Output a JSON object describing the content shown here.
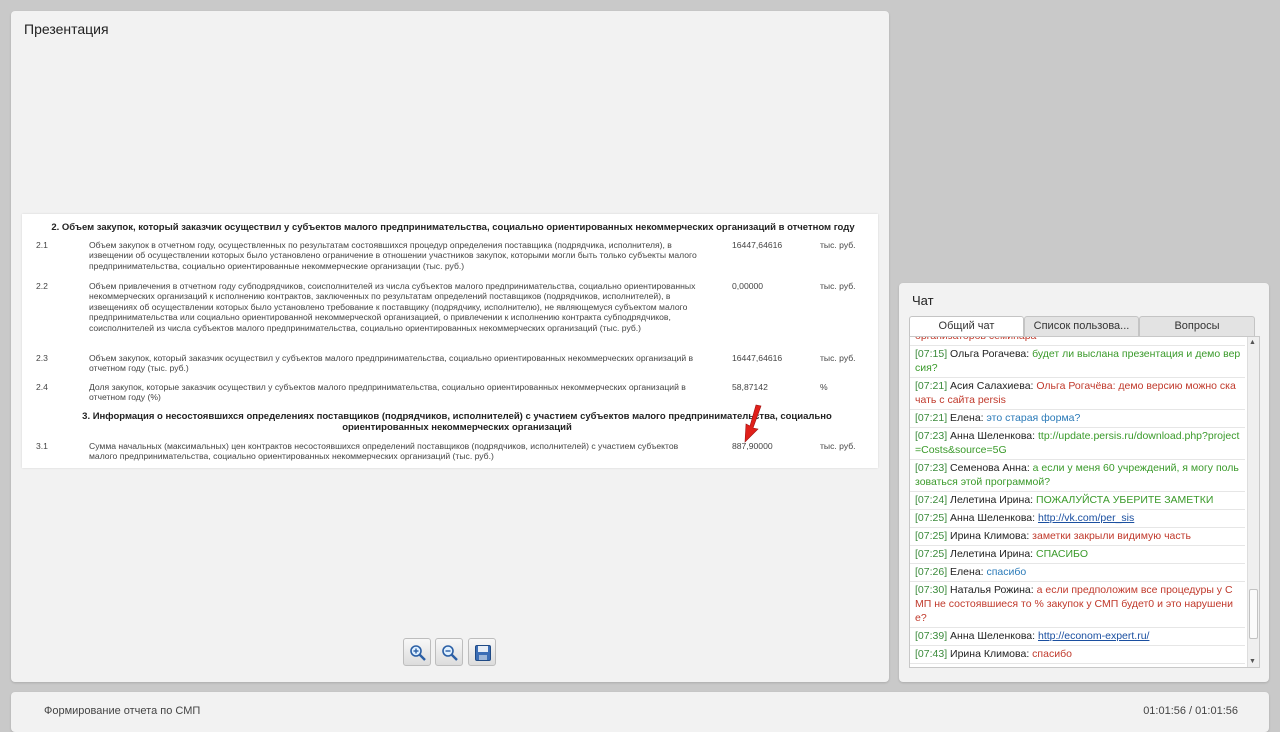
{
  "presentation": {
    "title": "Презентация",
    "section2_title": "2. Объем закупок, который заказчик осуществил у субъектов малого предпринимательства, социально ориентированных некоммерческих организаций в отчетном году",
    "rows": [
      {
        "num": "2.1",
        "desc": "Объем закупок в отчетном году, осуществленных по результатам состоявшихся процедур определения поставщика (подрядчика, исполнителя), в извещении об осуществлении которых было установлено ограничение в отношении участников закупок, которыми могли быть только субъекты малого предпринимательства, социально ориентированные некоммерческие организации (тыс. руб.)",
        "value": "16447,64616",
        "unit": "тыс. руб."
      },
      {
        "num": "2.2",
        "desc": "Объем привлечения в отчетном году субподрядчиков, соисполнителей из числа субъектов малого предпринимательства, социально ориентированных некоммерческих организаций к исполнению контрактов, заключенных по результатам определений поставщиков (подрядчиков, исполнителей), в извещениях об осуществлении которых было установлено требование к поставщику (подрядчику, исполнителю), не являющемуся субъектом малого предпринимательства или социально ориентированной некоммерческой организацией, о привлечении к исполнению контракта субподрядчиков, соисполнителей из числа субъектов малого предпринимательства, социально ориентированных некоммерческих организаций (тыс. руб.)",
        "value": "0,00000",
        "unit": "тыс. руб."
      },
      {
        "num": "2.3",
        "desc": "Объем закупок, который заказчик осуществил у субъектов малого предпринимательства, социально ориентированных некоммерческих организаций в отчетном году (тыс. руб.)",
        "value": "16447,64616",
        "unit": "тыс. руб."
      },
      {
        "num": "2.4",
        "desc": "Доля закупок, которые заказчик осуществил у субъектов малого предпринимательства, социально ориентированных некоммерческих организаций в отчетном году (%)",
        "value": "58,87142",
        "unit": "%"
      }
    ],
    "section3_title": "3. Информация о несостоявшихся определениях поставщиков (подрядчиков, исполнителей) с участием субъектов малого предпринимательства, социально ориентированных некоммерческих организаций",
    "row31": {
      "num": "3.1",
      "desc": "Сумма начальных (максимальных) цен контрактов несостоявшихся определений поставщиков (подрядчиков, исполнителей) с участием субъектов малого предпринимательства, социально ориентированных некоммерческих организаций (тыс. руб.)",
      "value": "887,90000",
      "unit": "тыс. руб."
    },
    "toolbar": [
      "zoom-in-icon",
      "zoom-out-icon",
      "save-icon"
    ]
  },
  "chat": {
    "title": "Чат",
    "tabs": [
      "Общий чат",
      "Список пользова...",
      "Вопросы"
    ],
    "messages": [
      {
        "time": "",
        "name": "",
        "text": "организаторов семинара",
        "color": "red"
      },
      {
        "time": "[07:15]",
        "name": "Ольга Рогачева:",
        "text": "будет ли выслана презентация и демо версия?",
        "color": "green"
      },
      {
        "time": "[07:21]",
        "name": "Асия Салахиева:",
        "text": "Ольга Рогачёва: демо версию можно скачать с сайта persis",
        "color": "red"
      },
      {
        "time": "[07:21]",
        "name": "Елена:",
        "text": "это старая форма?",
        "color": "blue"
      },
      {
        "time": "[07:23]",
        "name": "Анна Шеленкова:",
        "text": "ttp://update.persis.ru/download.php?project=Costs&source=5G",
        "color": "green"
      },
      {
        "time": "[07:23]",
        "name": "Семенова Анна:",
        "text": "а если у меня 60 учреждений, я могу пользоваться этой программой?",
        "color": "green"
      },
      {
        "time": "[07:24]",
        "name": "Лелетина Ирина:",
        "text": "ПОЖАЛУЙСТА УБЕРИТЕ ЗАМЕТКИ",
        "color": "green"
      },
      {
        "time": "[07:25]",
        "name": "Анна Шеленкова:",
        "text": "http://vk.com/per_sis",
        "color": "link"
      },
      {
        "time": "[07:25]",
        "name": "Ирина Климова:",
        "text": "заметки закрыли видимую часть",
        "color": "red"
      },
      {
        "time": "[07:25]",
        "name": "Лелетина Ирина:",
        "text": "СПАСИБО",
        "color": "green"
      },
      {
        "time": "[07:26]",
        "name": "Елена:",
        "text": "спасибо",
        "color": "blue"
      },
      {
        "time": "[07:30]",
        "name": "Наталья Рожина:",
        "text": "а если предположим все процедуры у СМП не состоявшиеся то % закупок у СМП будет0 и это нарушение?",
        "color": "red"
      },
      {
        "time": "[07:39]",
        "name": "Анна Шеленкова:",
        "text": "http://econom-expert.ru/",
        "color": "link"
      },
      {
        "time": "[07:43]",
        "name": "Ирина Климова:",
        "text": "спасибо",
        "color": "red"
      }
    ]
  },
  "bottom": {
    "title": "Формирование отчета по СМП",
    "time": "01:01:56 / 01:01:56"
  }
}
